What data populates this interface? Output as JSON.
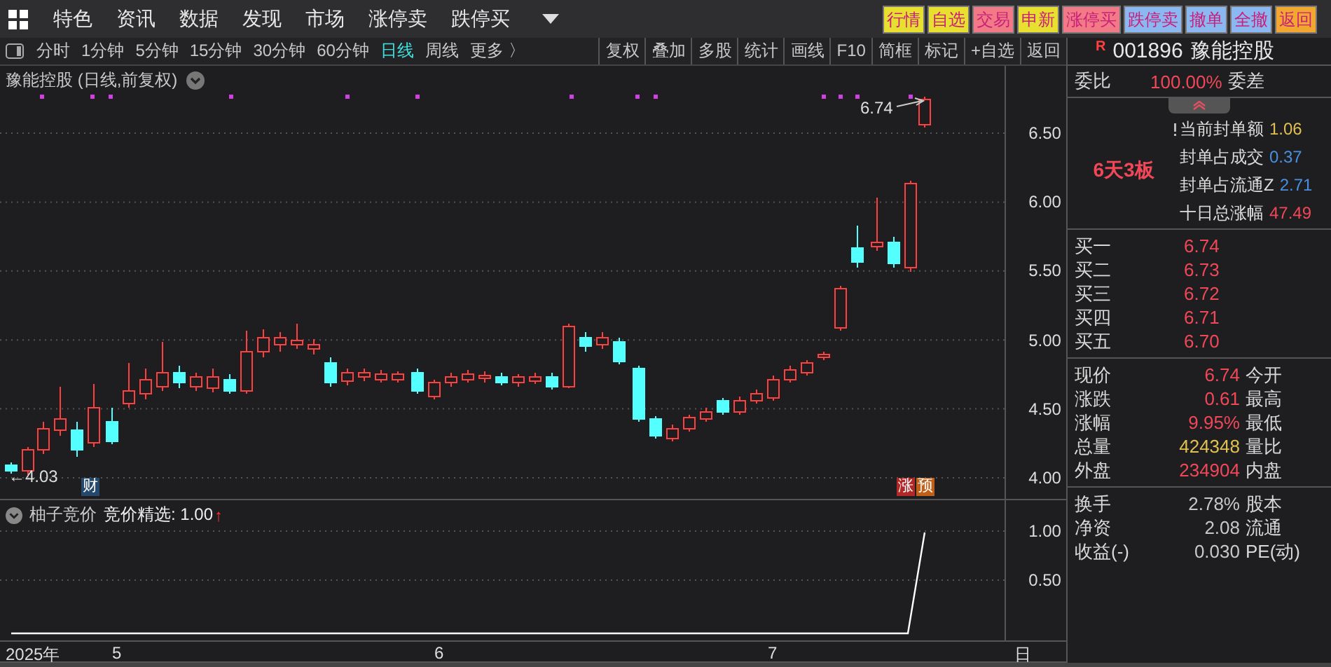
{
  "menu": {
    "items": [
      "特色",
      "资讯",
      "数据",
      "发现",
      "市场",
      "涨停卖",
      "跌停买"
    ]
  },
  "quick_buttons": [
    {
      "label": "行情",
      "color": "#e8e030"
    },
    {
      "label": "自选",
      "color": "#e8e030"
    },
    {
      "label": "交易",
      "color": "#f27a86"
    },
    {
      "label": "申新",
      "color": "#e8e030"
    },
    {
      "label": "涨停买",
      "color": "#f27a86"
    },
    {
      "label": "跌停卖",
      "color": "#8cb8f2"
    },
    {
      "label": "撤单",
      "color": "#8cb8f2"
    },
    {
      "label": "全撤",
      "color": "#8cb8f2"
    },
    {
      "label": "返回",
      "color": "#f2a830"
    }
  ],
  "periods": [
    {
      "label": "分时",
      "selected": false
    },
    {
      "label": "1分钟",
      "selected": false
    },
    {
      "label": "5分钟",
      "selected": false
    },
    {
      "label": "15分钟",
      "selected": false
    },
    {
      "label": "30分钟",
      "selected": false
    },
    {
      "label": "60分钟",
      "selected": false
    },
    {
      "label": "日线",
      "selected": true
    },
    {
      "label": "周线",
      "selected": false
    },
    {
      "label": "更多 〉",
      "selected": false
    }
  ],
  "tools": [
    "复权",
    "叠加",
    "多股",
    "统计",
    "画线",
    "F10",
    "简框",
    "标记",
    "+自选",
    "返回"
  ],
  "stock": {
    "badge": "R",
    "code": "001896",
    "name": "豫能控股"
  },
  "chart": {
    "title": "豫能控股 (日线,前复权)",
    "price_ticks": [
      "6.50",
      "6.00",
      "5.50",
      "5.00",
      "4.50",
      "4.00"
    ],
    "high_label": "6.74",
    "low_label": "←4.03",
    "badges": [
      {
        "text": "财",
        "kind": "finance"
      },
      {
        "text": "涨",
        "kind": "limit"
      },
      {
        "text": "预",
        "kind": "forecast"
      }
    ]
  },
  "indicator": {
    "name": "柚子竞价",
    "reading": "竞价精选: 1.00",
    "arrow": "↑",
    "ticks": [
      "1.00",
      "0.50"
    ]
  },
  "dates": [
    "2025年",
    "5",
    "6",
    "7",
    "日"
  ],
  "quote": {
    "ratio_label": "委比",
    "ratio": "100.00%",
    "diff_label": "委差",
    "streak": "6天3板",
    "seal": [
      {
        "label": "当前封单额",
        "value": "1.06",
        "color": "#e0c050"
      },
      {
        "label": "封单占成交",
        "value": "0.37",
        "color": "#4a90e0"
      },
      {
        "label": "封单占流通Z",
        "value": "2.71",
        "color": "#4a90e0"
      },
      {
        "label": "十日总涨幅",
        "value": "47.49",
        "color": "#f04858"
      }
    ],
    "bids": [
      {
        "label": "买一",
        "price": "6.74"
      },
      {
        "label": "买二",
        "price": "6.73"
      },
      {
        "label": "买三",
        "price": "6.72"
      },
      {
        "label": "买四",
        "price": "6.71"
      },
      {
        "label": "买五",
        "price": "6.70"
      }
    ],
    "stats": [
      {
        "label": "现价",
        "value": "6.74",
        "label2": "今开",
        "color": "#f04858"
      },
      {
        "label": "涨跌",
        "value": "0.61",
        "label2": "最高",
        "color": "#f04858"
      },
      {
        "label": "涨幅",
        "value": "9.95%",
        "label2": "最低",
        "color": "#f04858"
      },
      {
        "label": "总量",
        "value": "424348",
        "label2": "量比",
        "color": "#e0c050"
      },
      {
        "label": "外盘",
        "value": "234904",
        "label2": "内盘",
        "color": "#f04858"
      }
    ],
    "stats2": [
      {
        "label": "换手",
        "value": "2.78%",
        "label2": "股本",
        "color": "#c8c8c8"
      },
      {
        "label": "净资",
        "value": "2.08",
        "label2": "流通",
        "color": "#c8c8c8"
      },
      {
        "label": "收益(-)",
        "value": "0.030",
        "label2": "PE(动)",
        "color": "#c8c8c8"
      }
    ]
  }
}
